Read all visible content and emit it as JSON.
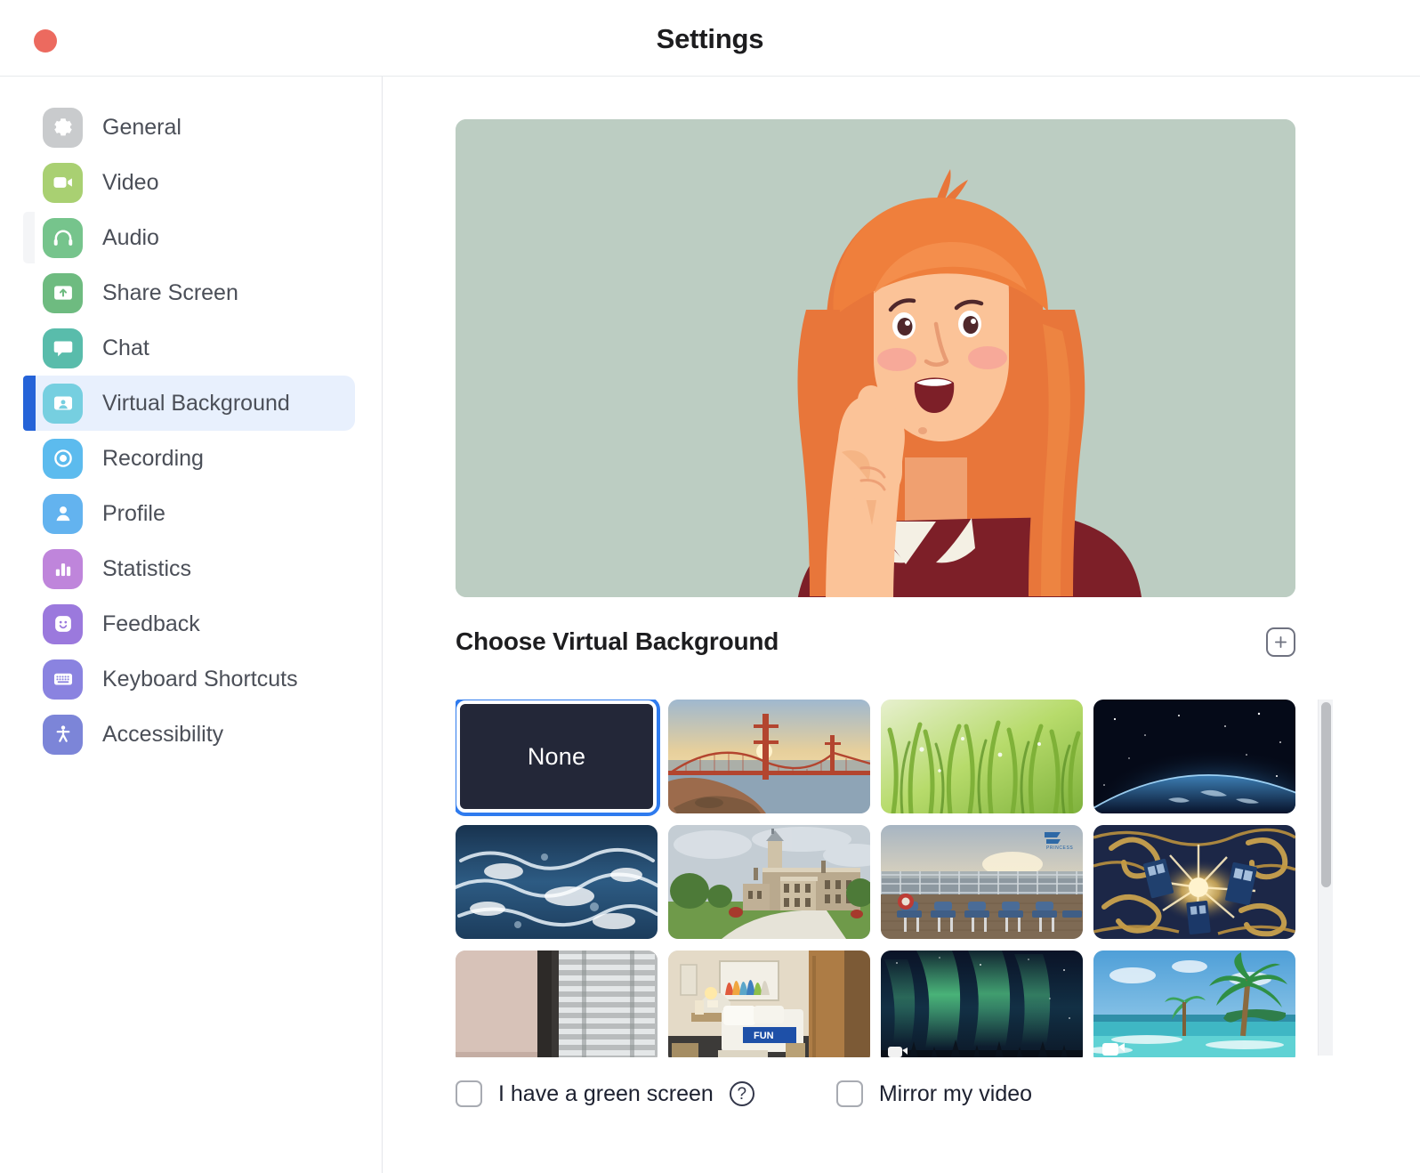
{
  "window": {
    "title": "Settings",
    "close_button": "close-window"
  },
  "sidebar": {
    "items": [
      {
        "label": "General",
        "icon": "gear-icon",
        "color": "#c9cbcd",
        "selected": false,
        "faint": false
      },
      {
        "label": "Video",
        "icon": "video-camera-icon",
        "color": "#a9d072",
        "selected": false,
        "faint": false
      },
      {
        "label": "Audio",
        "icon": "headphones-icon",
        "color": "#76c48c",
        "selected": false,
        "faint": true
      },
      {
        "label": "Share Screen",
        "icon": "share-screen-icon",
        "color": "#6ebb80",
        "selected": false,
        "faint": false
      },
      {
        "label": "Chat",
        "icon": "chat-bubble-icon",
        "color": "#59bcab",
        "selected": false,
        "faint": false
      },
      {
        "label": "Virtual Background",
        "icon": "virtual-background-icon",
        "color": "#76cfe0",
        "selected": true,
        "faint": false
      },
      {
        "label": "Recording",
        "icon": "record-circle-icon",
        "color": "#5cbbee",
        "selected": false,
        "faint": false
      },
      {
        "label": "Profile",
        "icon": "person-icon",
        "color": "#63b3ef",
        "selected": false,
        "faint": false
      },
      {
        "label": "Statistics",
        "icon": "bar-chart-icon",
        "color": "#bf85db",
        "selected": false,
        "faint": false
      },
      {
        "label": "Feedback",
        "icon": "smiley-face-icon",
        "color": "#9b79dd",
        "selected": false,
        "faint": false
      },
      {
        "label": "Keyboard Shortcuts",
        "icon": "keyboard-icon",
        "color": "#8a83e0",
        "selected": false,
        "faint": false
      },
      {
        "label": "Accessibility",
        "icon": "accessibility-icon",
        "color": "#7c85d8",
        "selected": false,
        "faint": false
      }
    ]
  },
  "main": {
    "preview": {
      "name": "video-preview",
      "background_color": "#bccdc2",
      "description": "cartoon woman with orange hair raising index finger"
    },
    "section": {
      "title": "Choose Virtual Background",
      "add_button_label": "+"
    },
    "backgrounds": [
      {
        "name": "None",
        "selected": true,
        "kind": "none"
      },
      {
        "name": "Golden Gate Bridge at sunset",
        "selected": false,
        "kind": "bridge"
      },
      {
        "name": "Green grass",
        "selected": false,
        "kind": "grass"
      },
      {
        "name": "Earth from space",
        "selected": false,
        "kind": "space"
      },
      {
        "name": "Ocean waves",
        "selected": false,
        "kind": "ocean"
      },
      {
        "name": "Old Main building",
        "selected": false,
        "kind": "campus"
      },
      {
        "name": "Cruise ship deck",
        "selected": false,
        "kind": "cruise"
      },
      {
        "name": "Van Gogh TARDIS painting",
        "selected": false,
        "kind": "vangogh"
      },
      {
        "name": "Balcony blinds",
        "selected": false,
        "kind": "balcony"
      },
      {
        "name": "Hotel room",
        "selected": false,
        "kind": "hotel"
      },
      {
        "name": "Northern lights",
        "selected": false,
        "kind": "aurora"
      },
      {
        "name": "Tropical beach",
        "selected": false,
        "kind": "beach"
      }
    ],
    "scrollbar": {
      "name": "background-grid-scrollbar",
      "thumb_percent": 52
    },
    "controls": {
      "green_screen_label": "I have a green screen",
      "green_screen_checked": false,
      "help_glyph": "?",
      "mirror_label": "Mirror my video",
      "mirror_checked": false
    }
  },
  "colors": {
    "accent": "#2563d8",
    "selected_row_bg": "#e8f0fd",
    "none_tile_bg": "#232738",
    "none_tile_border": "#2f7bee",
    "preview_bg": "#bccdc2",
    "close_button": "#ec6a5f"
  }
}
